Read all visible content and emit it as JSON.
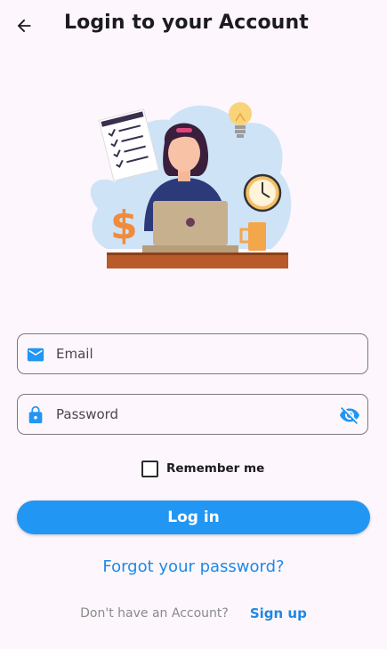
{
  "appbar": {
    "title": "Login to your Account",
    "back_icon": "arrow-back-icon"
  },
  "illustration": {
    "description_icon": "person-at-laptop-illustration"
  },
  "email": {
    "placeholder": "Email",
    "icon": "mail-icon",
    "value": ""
  },
  "password": {
    "placeholder": "Password",
    "icon": "lock-icon",
    "toggle_icon": "visibility-off-icon",
    "value": ""
  },
  "remember": {
    "label": "Remember me",
    "checked": false
  },
  "login": {
    "label": "Log in"
  },
  "forgot": {
    "label": "Forgot your password?"
  },
  "signup": {
    "prompt": "Don't have an Account?",
    "link": "Sign up"
  },
  "colors": {
    "accent": "#2196f3",
    "link": "#1e88e5",
    "background": "#fdf7fd"
  }
}
